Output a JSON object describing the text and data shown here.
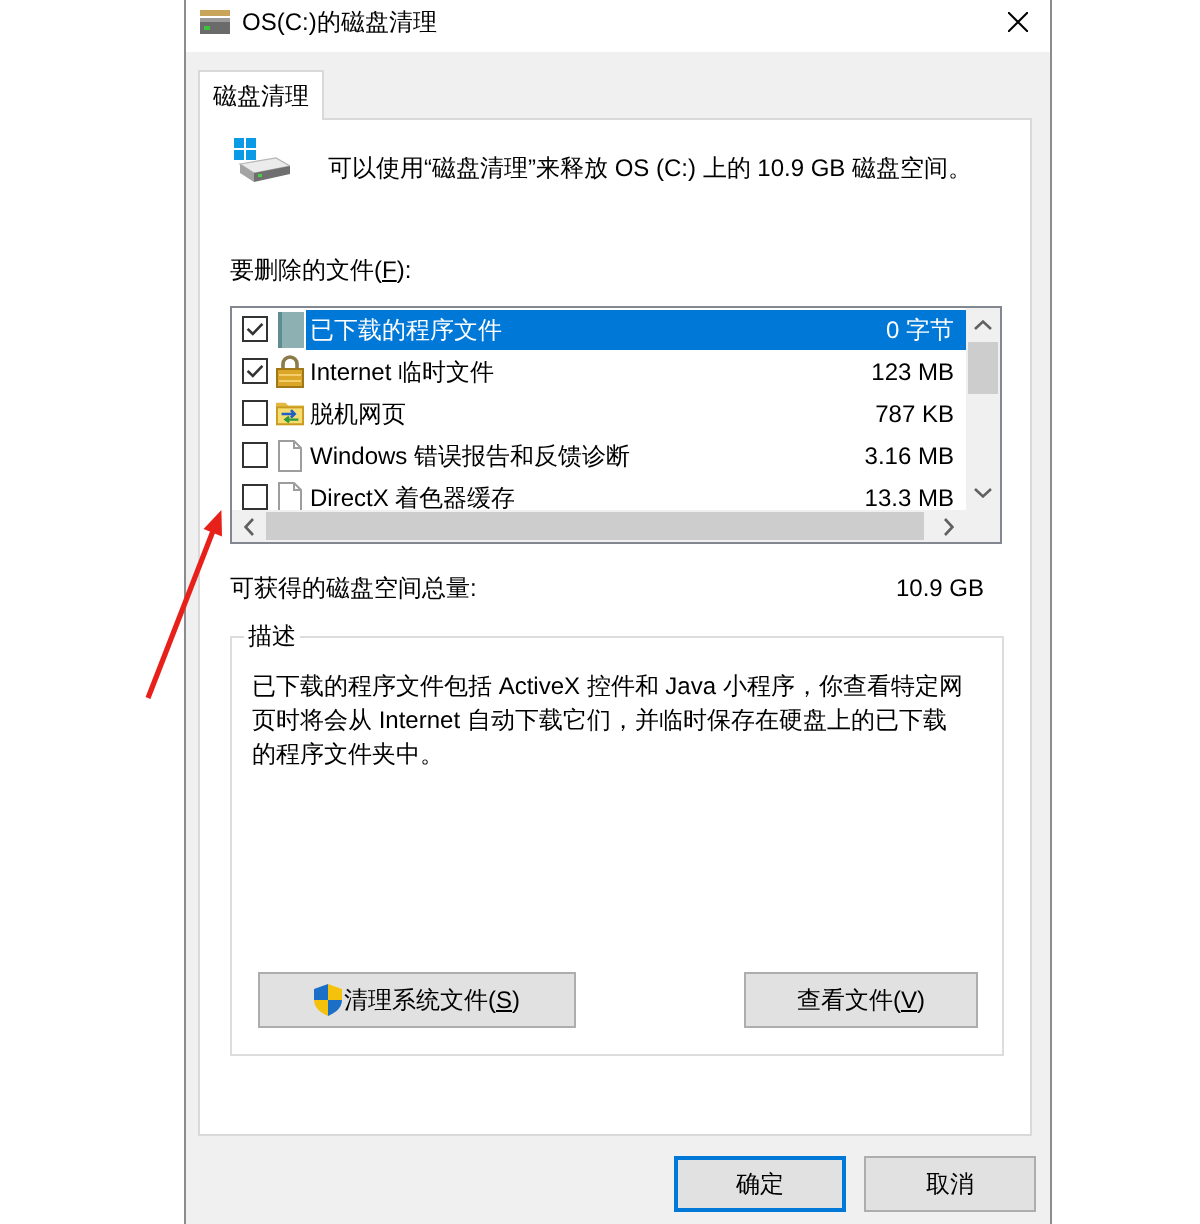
{
  "window": {
    "title": "OS(C:)的磁盘清理"
  },
  "tabs": [
    {
      "label": "磁盘清理",
      "selected": true
    }
  ],
  "header": {
    "message": "可以使用“磁盘清理”来释放 OS (C:) 上的 10.9 GB 磁盘空间。"
  },
  "file_list": {
    "label": "要删除的文件(",
    "access_key": "F",
    "label_end": "):",
    "items": [
      {
        "kind": "binder",
        "name": "已下载的程序文件",
        "size": "0 字节",
        "checked": true,
        "selected": true
      },
      {
        "kind": "lock",
        "name": "Internet 临时文件",
        "size": "123 MB",
        "checked": true,
        "selected": false
      },
      {
        "kind": "folder",
        "name": "脱机网页",
        "size": "787 KB",
        "checked": false,
        "selected": false
      },
      {
        "kind": "document",
        "name": "Windows 错误报告和反馈诊断",
        "size": "3.16 MB",
        "checked": false,
        "selected": false
      },
      {
        "kind": "document",
        "name": "DirectX 着色器缓存",
        "size": "13.3 MB",
        "checked": false,
        "selected": false
      }
    ]
  },
  "total": {
    "label": "可获得的磁盘空间总量:",
    "value": "10.9 GB"
  },
  "description": {
    "title": "描述",
    "text": "已下载的程序文件包括 ActiveX 控件和 Java 小程序，你查看特定网页时将会从 Internet 自动下载它们，并临时保存在硬盘上的已下载的程序文件夹中。"
  },
  "panel_buttons": [
    {
      "label": "清理系统文件(",
      "access_key": "S",
      "label_end": ")",
      "shield": true
    },
    {
      "label": "查看文件(",
      "access_key": "V",
      "label_end": ")",
      "shield": false
    }
  ],
  "dialog_buttons": [
    {
      "label": "确定",
      "default": true
    },
    {
      "label": "取消",
      "default": false
    }
  ]
}
